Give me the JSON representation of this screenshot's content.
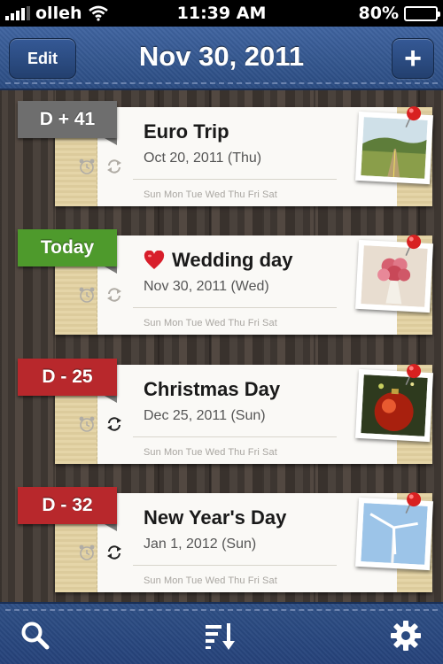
{
  "status_bar": {
    "carrier": "olleh",
    "time": "11:39 AM",
    "battery": "80%",
    "battery_level": 0.8
  },
  "nav": {
    "edit_label": "Edit",
    "title": "Nov 30, 2011",
    "add_label": "+"
  },
  "weekdays": "Sun Mon Tue Wed Thu Fri Sat",
  "events": [
    {
      "badge": "D + 41",
      "badge_color": "#6e6e6e",
      "title": "Euro Trip",
      "date": "Oct 20, 2011 (Thu)",
      "has_heart": false,
      "repeat_active": false,
      "photo": "road-landscape"
    },
    {
      "badge": "Today",
      "badge_color": "#4e9a2c",
      "title": "Wedding day",
      "date": "Nov 30, 2011 (Wed)",
      "has_heart": true,
      "repeat_active": false,
      "photo": "bouquet"
    },
    {
      "badge": "D - 25",
      "badge_color": "#b8282c",
      "title": "Christmas Day",
      "date": "Dec 25, 2011 (Sun)",
      "has_heart": false,
      "repeat_active": true,
      "photo": "christmas-ornament"
    },
    {
      "badge": "D - 32",
      "badge_color": "#b8282c",
      "title": "New Year's Day",
      "date": "Jan 1, 2012 (Sun)",
      "has_heart": false,
      "repeat_active": true,
      "photo": "wind-turbine"
    }
  ],
  "tab_bar": {
    "icons": [
      "search-icon",
      "sort-icon",
      "gear-icon"
    ]
  }
}
